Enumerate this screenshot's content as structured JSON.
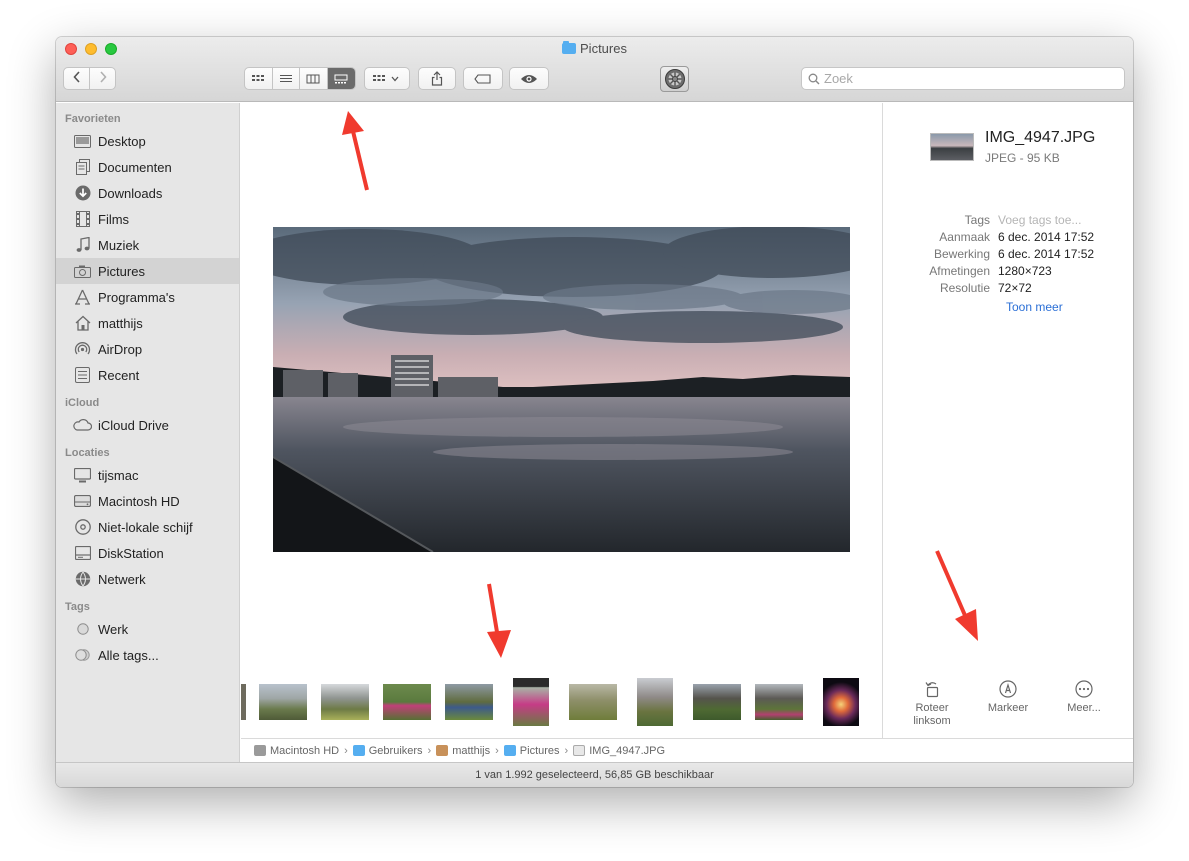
{
  "window": {
    "title": "Pictures"
  },
  "toolbar": {
    "back_icon": "chevron-left-icon",
    "forward_icon": "chevron-right-icon",
    "view_modes": [
      "icon-view",
      "list-view",
      "column-view",
      "gallery-view"
    ],
    "active_view": "gallery-view",
    "search_placeholder": "Zoek"
  },
  "sidebar": {
    "favorites_heading": "Favorieten",
    "favorites": [
      {
        "label": "Desktop",
        "icon": "desktop-icon"
      },
      {
        "label": "Documenten",
        "icon": "documents-icon"
      },
      {
        "label": "Downloads",
        "icon": "downloads-icon"
      },
      {
        "label": "Films",
        "icon": "film-icon"
      },
      {
        "label": "Muziek",
        "icon": "music-icon"
      },
      {
        "label": "Pictures",
        "icon": "camera-icon",
        "active": true
      },
      {
        "label": "Programma's",
        "icon": "apps-icon"
      },
      {
        "label": "matthijs",
        "icon": "home-icon"
      },
      {
        "label": "AirDrop",
        "icon": "airdrop-icon"
      },
      {
        "label": "Recent",
        "icon": "recent-icon"
      }
    ],
    "icloud_heading": "iCloud",
    "icloud": [
      {
        "label": "iCloud Drive",
        "icon": "cloud-icon"
      }
    ],
    "locations_heading": "Locaties",
    "locations": [
      {
        "label": "tijsmac",
        "icon": "computer-icon"
      },
      {
        "label": "Macintosh HD",
        "icon": "hard-drive-icon"
      },
      {
        "label": "Niet-lokale schijf",
        "icon": "disc-icon"
      },
      {
        "label": "DiskStation",
        "icon": "server-icon"
      },
      {
        "label": "Netwerk",
        "icon": "network-icon"
      }
    ],
    "tags_heading": "Tags",
    "tags": [
      {
        "label": "Werk",
        "icon": "tag-circle-icon"
      },
      {
        "label": "Alle tags...",
        "icon": "all-tags-icon"
      }
    ]
  },
  "inspector": {
    "file_name": "IMG_4947.JPG",
    "file_kind": "JPEG - 95 KB",
    "metadata": [
      {
        "label": "Tags",
        "value": "Voeg tags toe...",
        "placeholder": true
      },
      {
        "label": "Aanmaak",
        "value": "6 dec. 2014 17:52"
      },
      {
        "label": "Bewerking",
        "value": "6 dec. 2014 17:52"
      },
      {
        "label": "Afmetingen",
        "value": "1280×723"
      },
      {
        "label": "Resolutie",
        "value": "72×72"
      }
    ],
    "show_more": "Toon meer",
    "actions": [
      {
        "label": "Roteer linksom",
        "icon": "rotate-left-icon"
      },
      {
        "label": "Markeer",
        "icon": "markup-icon"
      },
      {
        "label": "Meer...",
        "icon": "more-icon"
      }
    ]
  },
  "pathbar": [
    "Macintosh HD",
    "Gebruikers",
    "matthijs",
    "Pictures",
    "IMG_4947.JPG"
  ],
  "status": "1 van 1.992 geselecteerd, 56,85 GB beschikbaar",
  "colors": {
    "arrow": "#f03a2e",
    "folder": "#55aef0",
    "link": "#2b6fd6"
  }
}
